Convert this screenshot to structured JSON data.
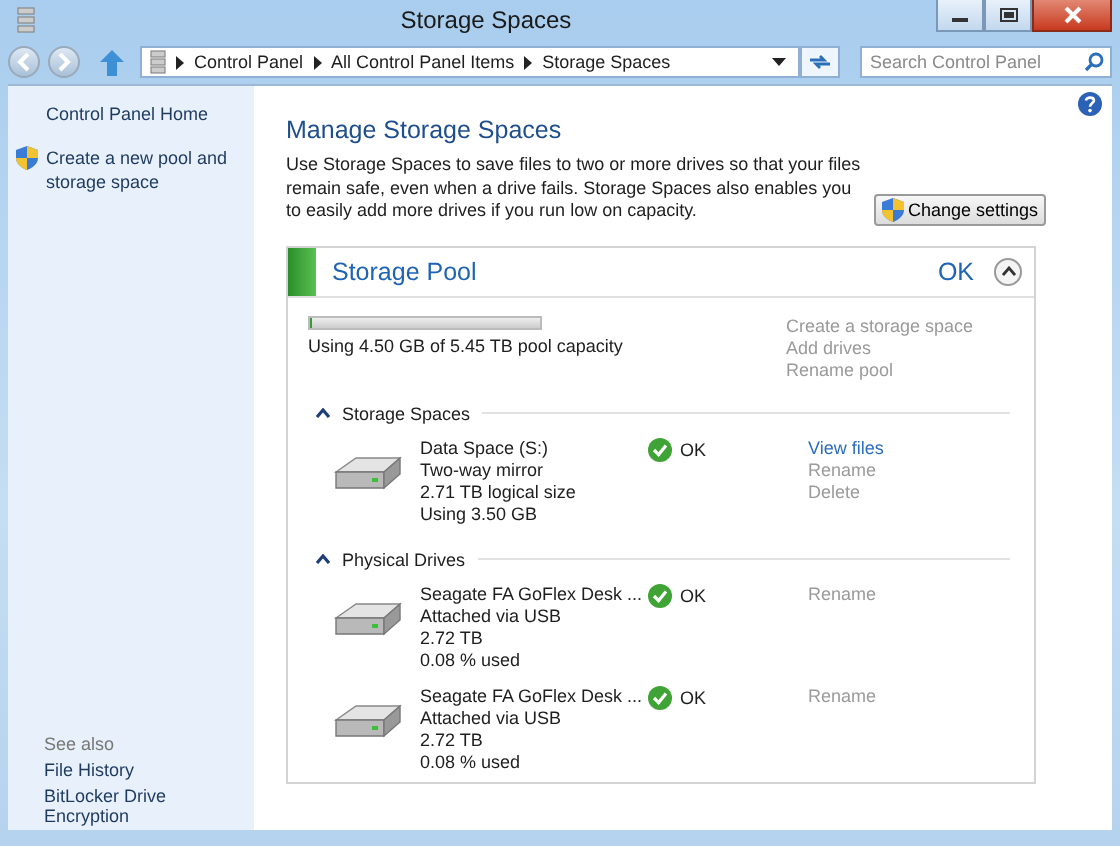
{
  "window": {
    "title": "Storage Spaces"
  },
  "address_bar": {
    "path": [
      "Control Panel",
      "All Control Panel Items",
      "Storage Spaces"
    ]
  },
  "search": {
    "placeholder": "Search Control Panel"
  },
  "sidebar": {
    "items": [
      {
        "label": "Control Panel Home",
        "kind": "link"
      },
      {
        "label": "Create a new pool and storage space",
        "kind": "shield"
      }
    ],
    "see_also": {
      "heading": "See also",
      "items": [
        "File History",
        "BitLocker Drive Encryption"
      ]
    }
  },
  "main": {
    "heading": "Manage Storage Spaces",
    "description": "Use Storage Spaces to save files to two or more drives so that your files remain safe, even when a drive fails. Storage Spaces also enables you to easily add more drives if you run low on capacity.",
    "change_settings": "Change settings"
  },
  "pool": {
    "name": "Storage Pool",
    "status": "OK",
    "expanded": true,
    "level": 0.001,
    "usage": "Using 4.50 GB of 5.45 TB pool capacity",
    "actions": [
      {
        "label": "Create a storage space",
        "disabled": true
      },
      {
        "label": "Add drives",
        "disabled": true
      },
      {
        "label": "Rename pool",
        "disabled": true
      }
    ],
    "sections": [
      {
        "title": "Storage Spaces",
        "expanded": true,
        "items": [
          {
            "lines": [
              "Data Space (S:)",
              "Two-way mirror",
              "2.71 TB logical size",
              "Using 3.50 GB"
            ],
            "status": "OK",
            "actions": [
              {
                "label": "View files",
                "disabled": false
              },
              {
                "label": "Rename",
                "disabled": true
              },
              {
                "label": "Delete",
                "disabled": true
              }
            ]
          }
        ]
      },
      {
        "title": "Physical Drives",
        "expanded": true,
        "items": [
          {
            "lines": [
              "Seagate FA GoFlex Desk ...",
              "Attached via USB",
              "2.72 TB",
              "0.08 % used"
            ],
            "status": "OK",
            "actions": [
              {
                "label": "Rename",
                "disabled": true
              }
            ]
          },
          {
            "lines": [
              "Seagate FA GoFlex Desk ...",
              "Attached via USB",
              "2.72 TB",
              "0.08 % used"
            ],
            "status": "OK",
            "actions": [
              {
                "label": "Rename",
                "disabled": true
              }
            ]
          }
        ]
      }
    ]
  }
}
